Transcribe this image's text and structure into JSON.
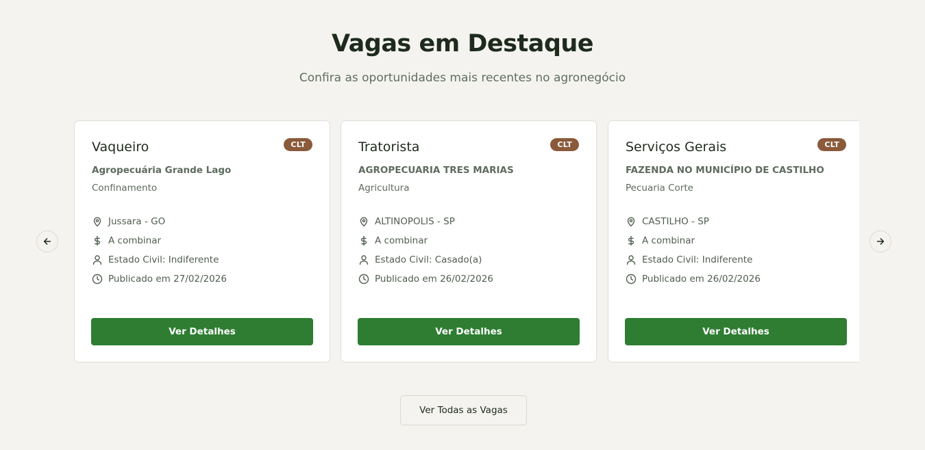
{
  "section": {
    "title": "Vagas em Destaque",
    "subtitle": "Confira as oportunidades mais recentes no agronegócio"
  },
  "icons": {
    "location": "map-pin-icon",
    "salary": "dollar-icon",
    "civil_status": "user-icon",
    "published": "clock-icon",
    "prev": "arrow-left-icon",
    "next": "arrow-right-icon"
  },
  "colors": {
    "background": "#f4f3ef",
    "primary_button": "#2e7d32",
    "badge": "#8a5a3b",
    "title": "#1e2a1c"
  },
  "cards": [
    {
      "title": "Vaqueiro",
      "badge": "CLT",
      "company": "Agropecuária Grande Lago",
      "sector": "Confinamento",
      "location": "Jussara - GO",
      "salary": "A combinar",
      "civil_status": "Estado Civil: Indiferente",
      "published": "Publicado em 27/02/2026",
      "button": "Ver Detalhes"
    },
    {
      "title": "Tratorista",
      "badge": "CLT",
      "company": "AGROPECUARIA TRES MARIAS",
      "sector": "Agricultura",
      "location": "ALTINOPOLIS - SP",
      "salary": "A combinar",
      "civil_status": "Estado Civil: Casado(a)",
      "published": "Publicado em 26/02/2026",
      "button": "Ver Detalhes"
    },
    {
      "title": "Serviços Gerais",
      "badge": "CLT",
      "company": "FAZENDA NO MUNICÍPIO DE CASTILHO",
      "sector": "Pecuaria Corte",
      "location": "CASTILHO - SP",
      "salary": "A combinar",
      "civil_status": "Estado Civil: Indiferente",
      "published": "Publicado em 26/02/2026",
      "button": "Ver Detalhes"
    }
  ],
  "view_all_label": "Ver Todas as Vagas"
}
